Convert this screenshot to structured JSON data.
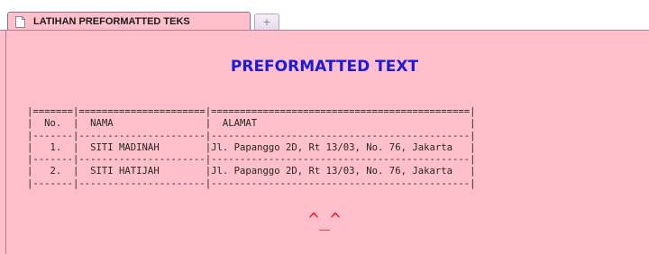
{
  "tabs": {
    "active_title": "LATIHAN PREFORMATTED TEKS",
    "new_tab_glyph": "+"
  },
  "page": {
    "heading": "PREFORMATTED TEXT",
    "preformatted_lines": [
      "|=======|======================|=============================================|",
      "|  No.  |  NAMA                |  ALAMAT                                     |",
      "|-------|----------------------|---------------------------------------------|",
      "|   1.  |  SITI MADINAH        |Jl. Papanggo 2D, Rt 13/03, No. 76, Jakarta   |",
      "|-------|----------------------|---------------------------------------------|",
      "|   2.  |  SITI HATIJAH        |Jl. Papanggo 2D, Rt 13/03, No. 76, Jakarta   |",
      "|-------|----------------------|---------------------------------------------|"
    ],
    "smiley": "^_^"
  },
  "colors": {
    "page_background": "#ffc0cb",
    "heading": "#1b1bd8",
    "smiley": "#ff1a1a"
  },
  "icons": {
    "tab_icon": "document-icon",
    "new_tab_icon": "plus-icon"
  }
}
